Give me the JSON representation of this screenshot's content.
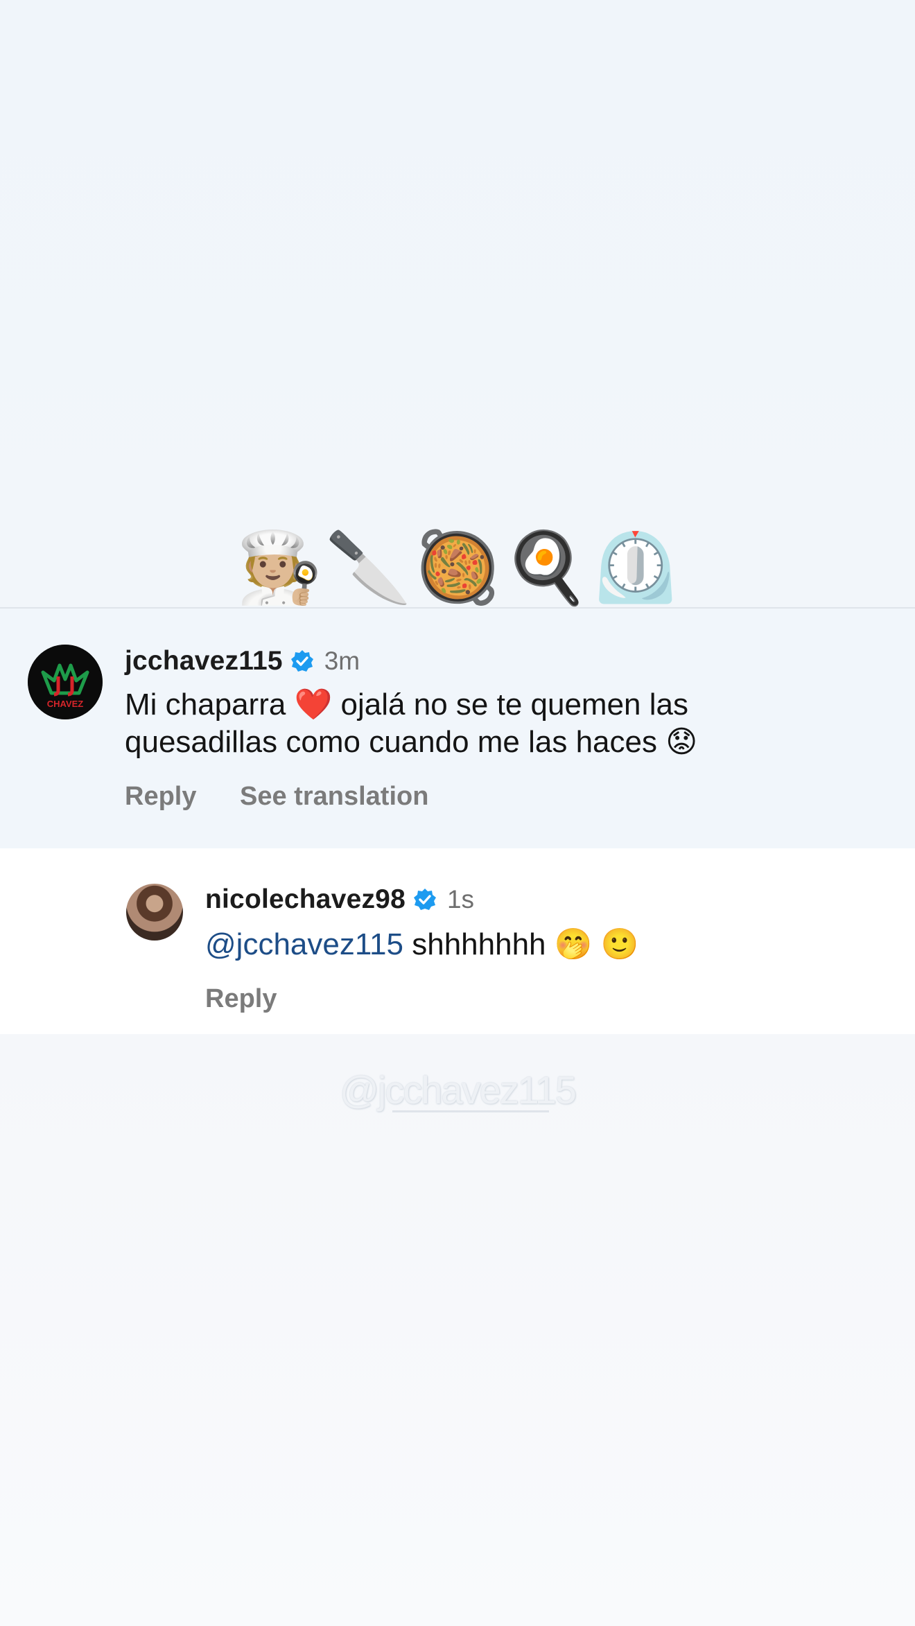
{
  "header_emojis": [
    "🧑🏼‍🍳",
    "🔪",
    "🥘",
    "🍳",
    "⏲️"
  ],
  "comment": {
    "username": "jcchavez115",
    "time": "3m",
    "text_line1": "Mi chaparra ❤️ ojalá no se te quemen las",
    "text_line2": "quesadillas como cuando me las haces 😟",
    "reply_label": "Reply",
    "translate_label": "See translation",
    "avatar_text": "CHAVEZ"
  },
  "reply": {
    "username": "nicolechavez98",
    "time": "1s",
    "mention": "@jcchavez115",
    "text": " shhhhhhh 🤭 🙂",
    "reply_label": "Reply"
  },
  "watermark": "@jcchavez115",
  "colors": {
    "verified_blue": "#1d9bf0",
    "mention": "#1d4d87",
    "card_bg": "#f1f6fb",
    "logo_green": "#1e9c4a",
    "logo_red": "#d6252a"
  }
}
